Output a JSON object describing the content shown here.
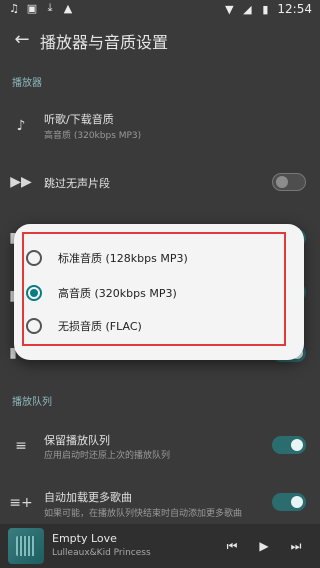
{
  "status": {
    "time": "12:54"
  },
  "appbar": {
    "title": "播放器与音质设置"
  },
  "sections": [
    {
      "label": "播放器"
    },
    {
      "label": "播放队列"
    }
  ],
  "items": [
    {
      "title": "听歌/下载音质",
      "subtitle": "高音质 (320kbps MP3)",
      "icon": "music-note-icon"
    },
    {
      "title": "跳过无声片段",
      "subtitle": "",
      "icon": "skip-forward-icon",
      "toggle": false
    },
    {
      "title": "保留播放队列",
      "subtitle": "应用启动时还原上次的播放队列",
      "icon": "queue-icon",
      "toggle": true
    },
    {
      "title": "自动加载更多歌曲",
      "subtitle": "如果可能，在播放队列快结束时自动添加更多歌曲",
      "icon": "queue-add-icon",
      "toggle": true
    }
  ],
  "dialog": {
    "options": [
      {
        "label": "标准音质 (128kbps MP3)",
        "selected": false
      },
      {
        "label": "高音质 (320kbps MP3)",
        "selected": true
      },
      {
        "label": "无损音质 (FLAC)",
        "selected": false
      }
    ]
  },
  "player": {
    "song": "Empty Love",
    "artist": "Lulleaux&Kid Princess"
  },
  "colors": {
    "accent": "#2b6d6f",
    "highlight_box": "#e03a3a"
  }
}
